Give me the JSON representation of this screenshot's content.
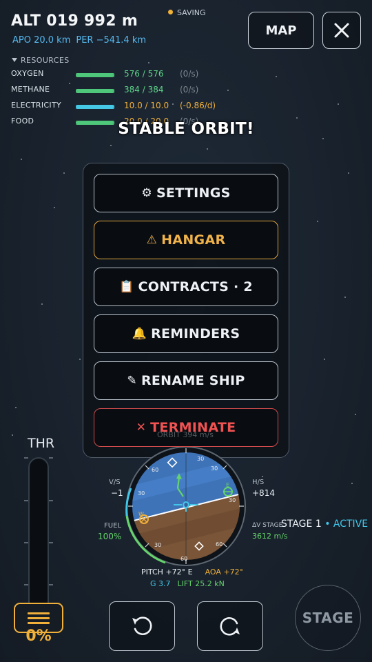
{
  "hud": {
    "altitude": "ALT 019 992 m",
    "apoapsis": "APO 20.0 km",
    "periapsis": "PER −541.4 km",
    "saving": "SAVING"
  },
  "top_buttons": {
    "map": "MAP",
    "close_icon": "close-icon"
  },
  "resources": {
    "header": "RESOURCES",
    "items": [
      {
        "name": "OXYGEN",
        "value": "576 / 576",
        "rate": "(0/s)",
        "fill": 1.0,
        "color": "#4ec77a",
        "value_color": "#5fd38a",
        "rate_color": "#7c8792"
      },
      {
        "name": "METHANE",
        "value": "384 / 384",
        "rate": "(0/s)",
        "fill": 1.0,
        "color": "#4ec77a",
        "value_color": "#5fd38a",
        "rate_color": "#7c8792"
      },
      {
        "name": "ELECTRICITY",
        "value": "10.0 / 10.0",
        "rate": "(-0.86/d)",
        "fill": 1.0,
        "color": "#44c8e6",
        "value_color": "#f0b03a",
        "rate_color": "#f0b03a"
      },
      {
        "name": "FOOD",
        "value": "20.0 / 20.0",
        "rate": "(0/s)",
        "fill": 1.0,
        "color": "#4ec77a",
        "value_color": "#f0b03a",
        "rate_color": "#7c8792"
      }
    ]
  },
  "banner": "STABLE ORBIT!",
  "menu": {
    "settings": {
      "icon": "gear-icon",
      "glyph": "⚙",
      "label": "SETTINGS"
    },
    "hangar": {
      "icon": "warning-icon",
      "glyph": "⚠",
      "label": "HANGAR"
    },
    "contracts": {
      "icon": "clipboard-icon",
      "glyph": "📋",
      "label": "CONTRACTS · 2"
    },
    "reminders": {
      "icon": "bell-icon",
      "glyph": "🔔",
      "label": "REMINDERS"
    },
    "rename": {
      "icon": "pencil-icon",
      "glyph": "✎",
      "label": "RENAME SHIP"
    },
    "terminate": {
      "icon": "x-icon",
      "glyph": "✕",
      "label": "TERMINATE"
    }
  },
  "throttle": {
    "label": "THR",
    "percent": "0%",
    "level": 0
  },
  "navball": {
    "orbit_label": "ORBIT",
    "orbit_speed": "394 m/s",
    "vs_label": "V/S",
    "vs_value": "−1",
    "hs_label": "H/S",
    "hs_value": "+814",
    "fuel_label": "FUEL",
    "fuel_value": "100%",
    "dv_label": "ΔV STAGE",
    "dv_value": "3612 m/s",
    "stage": "STAGE 1",
    "stage_status": "• ACTIVE",
    "pitch": "PITCH +72°  E",
    "aoa": "AOA +72°",
    "g": "G 3.7",
    "lift": "LIFT 25.2 kN",
    "ticks": [
      "60",
      "30",
      "30",
      "30",
      "60",
      "30",
      "30",
      "60"
    ],
    "markers": [
      "E",
      "W"
    ]
  },
  "controls": {
    "rotate_left": "rotate-left-icon",
    "rotate_right": "rotate-right-icon",
    "stage_button": "STAGE"
  },
  "colors": {
    "accent": "#f0b03a",
    "danger": "#f05252",
    "cyan": "#41c6e8",
    "green": "#65d46b",
    "sky": "#3f73b8",
    "ground": "#7a5538"
  }
}
